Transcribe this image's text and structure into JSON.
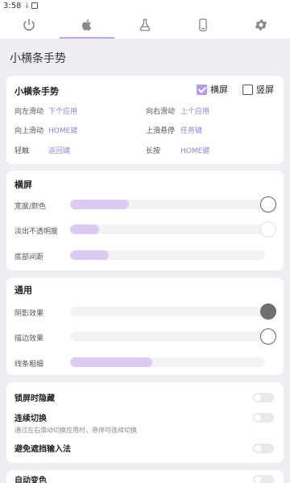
{
  "status": {
    "time": "3:58"
  },
  "tabs": [
    {
      "name": "power",
      "icon": "power-icon",
      "active": false
    },
    {
      "name": "apple",
      "icon": "apple-icon",
      "active": true
    },
    {
      "name": "lab",
      "icon": "flask-icon",
      "active": false
    },
    {
      "name": "device",
      "icon": "phone-icon",
      "active": false
    },
    {
      "name": "settings",
      "icon": "gear-icon",
      "active": false
    }
  ],
  "page_title": "小横条手势",
  "gesture": {
    "title": "小横条手势",
    "landscape_label": "横屏",
    "landscape_checked": true,
    "portrait_label": "竖屏",
    "portrait_checked": false,
    "rows": [
      {
        "l1": "向左滑动",
        "v1": "下个应用",
        "l2": "向右滑动",
        "v2": "上个应用"
      },
      {
        "l1": "向上滑动",
        "v1": "HOME键",
        "l2": "上滑悬停",
        "v2": "任务键"
      },
      {
        "l1": "轻触",
        "v1": "返回键",
        "l2": "长按",
        "v2": "HOME键"
      }
    ]
  },
  "landscape": {
    "title": "横屏",
    "sliders": [
      {
        "label": "宽度/颜色",
        "level": 0.3
      },
      {
        "label": "淡出不透明度",
        "level": 0.15
      },
      {
        "label": "底部间距",
        "level": 0.2
      }
    ]
  },
  "general": {
    "title": "通用",
    "sliders": [
      {
        "label": "阴影效果",
        "level": 0.0
      },
      {
        "label": "描边效果",
        "level": 0.0
      },
      {
        "label": "线条粗细",
        "level": 0.42
      }
    ]
  },
  "toggles": [
    {
      "label": "锁屏时隐藏",
      "sub": "",
      "on": false
    },
    {
      "label": "连续切换",
      "sub": "通过左右滑动切换应用时，悬停可连续切换",
      "on": false
    },
    {
      "label": "避免遮挡输入法",
      "sub": "",
      "on": false
    }
  ],
  "partial": {
    "label": "自动变色"
  },
  "colors": {
    "accent": "#b79ddf",
    "fill": "#dccbf0",
    "value_text": "#9a7fd6"
  }
}
